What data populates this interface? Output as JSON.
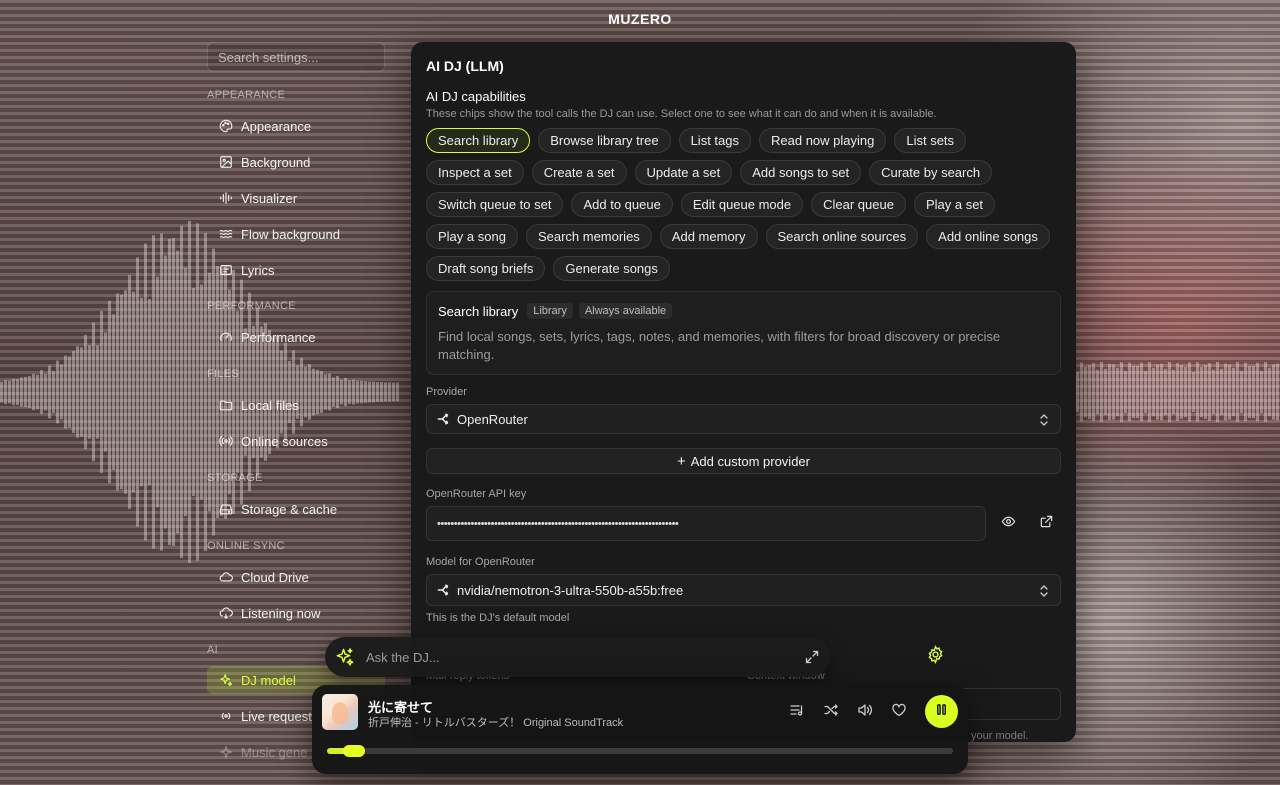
{
  "app": {
    "title": "MUZERO"
  },
  "sidebar": {
    "search_placeholder": "Search settings...",
    "sections": [
      {
        "title": "APPEARANCE",
        "items": [
          {
            "label": "Appearance",
            "icon": "palette-icon"
          },
          {
            "label": "Background",
            "icon": "image-icon"
          },
          {
            "label": "Visualizer",
            "icon": "audio-lines-icon"
          },
          {
            "label": "Flow background",
            "icon": "waves-icon"
          },
          {
            "label": "Lyrics",
            "icon": "lyrics-icon"
          }
        ]
      },
      {
        "title": "PERFORMANCE",
        "items": [
          {
            "label": "Performance",
            "icon": "gauge-icon"
          }
        ]
      },
      {
        "title": "FILES",
        "items": [
          {
            "label": "Local files",
            "icon": "folder-icon"
          },
          {
            "label": "Online sources",
            "icon": "radio-icon"
          }
        ]
      },
      {
        "title": "STORAGE",
        "items": [
          {
            "label": "Storage & cache",
            "icon": "hard-drive-icon"
          }
        ]
      },
      {
        "title": "ONLINE SYNC",
        "items": [
          {
            "label": "Cloud Drive",
            "icon": "cloud-icon"
          },
          {
            "label": "Listening now",
            "icon": "cloud-sync-icon"
          }
        ]
      },
      {
        "title": "AI",
        "items": [
          {
            "label": "DJ model",
            "icon": "sparkles-icon",
            "active": true
          },
          {
            "label": "Live request",
            "icon": "broadcast-icon"
          },
          {
            "label": "Music gene",
            "icon": "sparkle-icon"
          }
        ]
      }
    ]
  },
  "panel": {
    "title": "AI DJ (LLM)",
    "capabilities_title": "AI DJ capabilities",
    "capabilities_desc": "These chips show the tool calls the DJ can use. Select one to see what it can do and when it is available.",
    "chips": [
      "Search library",
      "Browse library tree",
      "List tags",
      "Read now playing",
      "List sets",
      "Inspect a set",
      "Create a set",
      "Update a set",
      "Add songs to set",
      "Curate by search",
      "Switch queue to set",
      "Add to queue",
      "Edit queue mode",
      "Clear queue",
      "Play a set",
      "Play a song",
      "Search memories",
      "Add memory",
      "Search online sources",
      "Add online songs",
      "Draft song briefs",
      "Generate songs"
    ],
    "selected_chip": "Search library",
    "detail": {
      "name": "Search library",
      "tag1": "Library",
      "tag2": "Always available",
      "desc": "Find local songs, sets, lyrics, tags, notes, and memories, with filters for broad discovery or precise matching."
    },
    "provider_label": "Provider",
    "provider_value": "OpenRouter",
    "add_provider_label": "Add custom provider",
    "api_key_label": "OpenRouter API key",
    "api_key_value": "••••••••••••••••••••••••••••••••••••••••••••••••••••••••••••••••••••••••",
    "model_label": "Model for OpenRouter",
    "model_value": "nvidia/nemotron-3-ultra-550b-a55b:free",
    "model_hint": "This is the DJ's default model",
    "max_tokens_label": "Max reply tokens",
    "context_label": "Context window",
    "context_hint": "your model."
  },
  "ask": {
    "placeholder": "Ask the DJ..."
  },
  "player": {
    "title": "光に寄せて",
    "subtitle": "折戸伸治 - リトルバスターズ！ Original SoundTrack",
    "progress": 0.05
  },
  "colors": {
    "accent": "#d8ff1f",
    "panel": "#1a1a1a"
  }
}
